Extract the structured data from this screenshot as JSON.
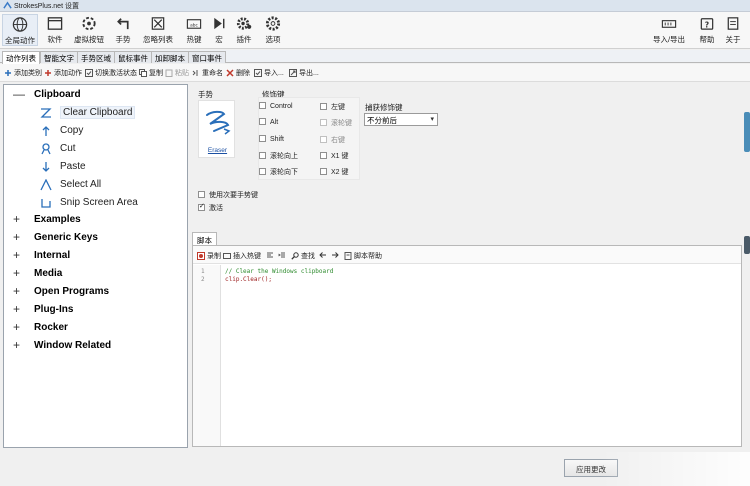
{
  "window": {
    "title": "StrokesPlus.net 设置"
  },
  "ribbon": {
    "items": [
      {
        "label": "全局动作",
        "icon": "globe-icon"
      },
      {
        "label": "软件",
        "icon": "window-icon"
      },
      {
        "label": "虚拟按钮",
        "icon": "dial-icon"
      },
      {
        "label": "手势",
        "icon": "gesture-arrow-icon"
      },
      {
        "label": "忽略列表",
        "icon": "ignore-list-icon"
      },
      {
        "label": "热键",
        "icon": "keyboard-icon"
      },
      {
        "label": "宏",
        "icon": "macro-icon"
      },
      {
        "label": "插件",
        "icon": "plugin-gear-icon"
      },
      {
        "label": "选项",
        "icon": "options-gear-icon"
      }
    ],
    "right_items": [
      {
        "label": "导入/导出",
        "icon": "import-export-icon"
      },
      {
        "label": "帮助",
        "icon": "help-icon"
      },
      {
        "label": "关于",
        "icon": "about-icon"
      }
    ]
  },
  "tabs": [
    "动作列表",
    "智能文字",
    "手势区域",
    "鼠标事件",
    "加卸脚本",
    "窗口事件"
  ],
  "toolbar": {
    "add_category": "添加类别",
    "add_action": "添加动作",
    "toggle_state": "切换激活状态",
    "copy": "复制",
    "paste": "粘贴",
    "rename": "重命名",
    "delete": "删除",
    "import": "导入...",
    "export": "导出..."
  },
  "tree": {
    "expanded_category": "Clipboard",
    "expanded_children": [
      {
        "label": "Clear Clipboard",
        "icon": "z-gesture-icon",
        "selected": true
      },
      {
        "label": "Copy",
        "icon": "up-arrow-gesture-icon"
      },
      {
        "label": "Cut",
        "icon": "loop-gesture-icon"
      },
      {
        "label": "Paste",
        "icon": "down-arrow-gesture-icon"
      },
      {
        "label": "Select All",
        "icon": "caret-gesture-icon"
      },
      {
        "label": "Snip Screen Area",
        "icon": "corner-gesture-icon"
      }
    ],
    "collapsed_categories": [
      "Examples",
      "Generic Keys",
      "Internal",
      "Media",
      "Open Programs",
      "Plug-Ins",
      "Rocker",
      "Window Related"
    ]
  },
  "detail": {
    "gesture_label": "手势",
    "gesture_name": "Eraser",
    "modifiers_label": "修饰键",
    "modifiers": [
      {
        "label": "Control",
        "checked": false
      },
      {
        "label": "Alt",
        "checked": false
      },
      {
        "label": "Shift",
        "checked": false
      },
      {
        "label": "滚轮向上",
        "checked": false
      },
      {
        "label": "滚轮向下",
        "checked": false
      }
    ],
    "mouse_buttons": [
      {
        "label": "左键",
        "checked": false,
        "disabled": false
      },
      {
        "label": "滚轮键",
        "checked": false,
        "disabled": true
      },
      {
        "label": "右键",
        "checked": false,
        "disabled": true
      },
      {
        "label": "X1 键",
        "checked": false,
        "disabled": false
      },
      {
        "label": "X2 键",
        "checked": false,
        "disabled": false
      }
    ],
    "capture_label": "捕获修饰键",
    "capture_value": "不分前后",
    "use_secondary": "使用次要手势键",
    "use_secondary_checked": false,
    "activate": "激活",
    "activate_checked": true
  },
  "script": {
    "tab_label": "脚本",
    "toolbar": {
      "record": "录制",
      "insert_hotkey": "插入热键",
      "find": "查找",
      "help": "脚本帮助"
    },
    "lines": [
      {
        "num": "1",
        "text": "// Clear the Windows clipboard"
      },
      {
        "num": "2",
        "text": "clip.Clear();"
      }
    ]
  },
  "footer": {
    "apply_button": "应用更改"
  },
  "colors": {
    "accent": "#2a6fba",
    "comment": "#2e8b2e",
    "keyword": "#9c1c1c"
  }
}
